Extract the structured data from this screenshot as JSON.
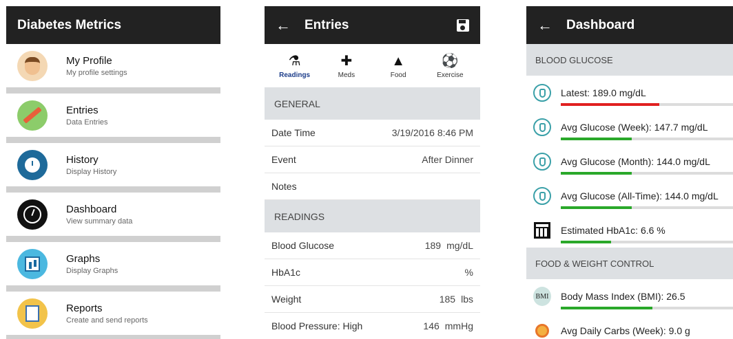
{
  "screen1": {
    "title": "Diabetes Metrics",
    "items": [
      {
        "icon": "profile-avatar-icon",
        "title": "My Profile",
        "subtitle": "My profile settings"
      },
      {
        "icon": "entries-pencil-icon",
        "title": "Entries",
        "subtitle": "Data Entries"
      },
      {
        "icon": "history-clock-icon",
        "title": "History",
        "subtitle": "Display History"
      },
      {
        "icon": "dashboard-gauge-icon",
        "title": "Dashboard",
        "subtitle": "View summary data"
      },
      {
        "icon": "graphs-chart-icon",
        "title": "Graphs",
        "subtitle": "Display Graphs"
      },
      {
        "icon": "reports-clipboard-icon",
        "title": "Reports",
        "subtitle": "Create and send reports"
      }
    ]
  },
  "screen2": {
    "title": "Entries",
    "tabs": [
      {
        "label": "Readings",
        "icon": "flask-icon",
        "glyph": "⚗"
      },
      {
        "label": "Meds",
        "icon": "medkit-icon",
        "glyph": "✚"
      },
      {
        "label": "Food",
        "icon": "pizza-icon",
        "glyph": "▲"
      },
      {
        "label": "Exercise",
        "icon": "soccer-ball-icon",
        "glyph": "⚽"
      }
    ],
    "general_header": "GENERAL",
    "general": [
      {
        "label": "Date Time",
        "value": "3/19/2016 8:46 PM",
        "unit": ""
      },
      {
        "label": "Event",
        "value": "After Dinner",
        "unit": ""
      },
      {
        "label": "Notes",
        "value": "",
        "unit": ""
      }
    ],
    "readings_header": "READINGS",
    "readings": [
      {
        "label": "Blood Glucose",
        "value": "189",
        "unit": "mg/dL"
      },
      {
        "label": "HbA1c",
        "value": "",
        "unit": "%"
      },
      {
        "label": "Weight",
        "value": "185",
        "unit": "lbs"
      },
      {
        "label": "Blood Pressure: High",
        "value": "146",
        "unit": "mmHg"
      }
    ]
  },
  "screen3": {
    "title": "Dashboard",
    "glucose_header": "BLOOD GLUCOSE",
    "glucose": [
      {
        "text": "Latest: 189.0 mg/dL",
        "level": 0.57,
        "color": "#e02020",
        "icon": "glucose-meter-icon"
      },
      {
        "text": "Avg Glucose (Week): 147.7 mg/dL",
        "level": 0.41,
        "color": "#2aa82a",
        "icon": "glucose-meter-icon"
      },
      {
        "text": "Avg Glucose (Month): 144.0 mg/dL",
        "level": 0.41,
        "color": "#2aa82a",
        "icon": "glucose-meter-icon"
      },
      {
        "text": "Avg Glucose (All-Time): 144.0 mg/dL",
        "level": 0.41,
        "color": "#2aa82a",
        "icon": "glucose-meter-icon"
      },
      {
        "text": "Estimated HbA1c: 6.6 %",
        "level": 0.29,
        "color": "#2aa82a",
        "icon": "calculator-icon"
      }
    ],
    "food_header": "FOOD & WEIGHT CONTROL",
    "food": [
      {
        "text": "Body Mass Index (BMI): 26.5",
        "badge": "BMI",
        "level": 0.53,
        "color": "#2aa82a",
        "icon": "bmi-badge-icon"
      },
      {
        "text": "Avg Daily Carbs (Week): 9.0 g",
        "icon": "carbs-icon"
      }
    ]
  }
}
